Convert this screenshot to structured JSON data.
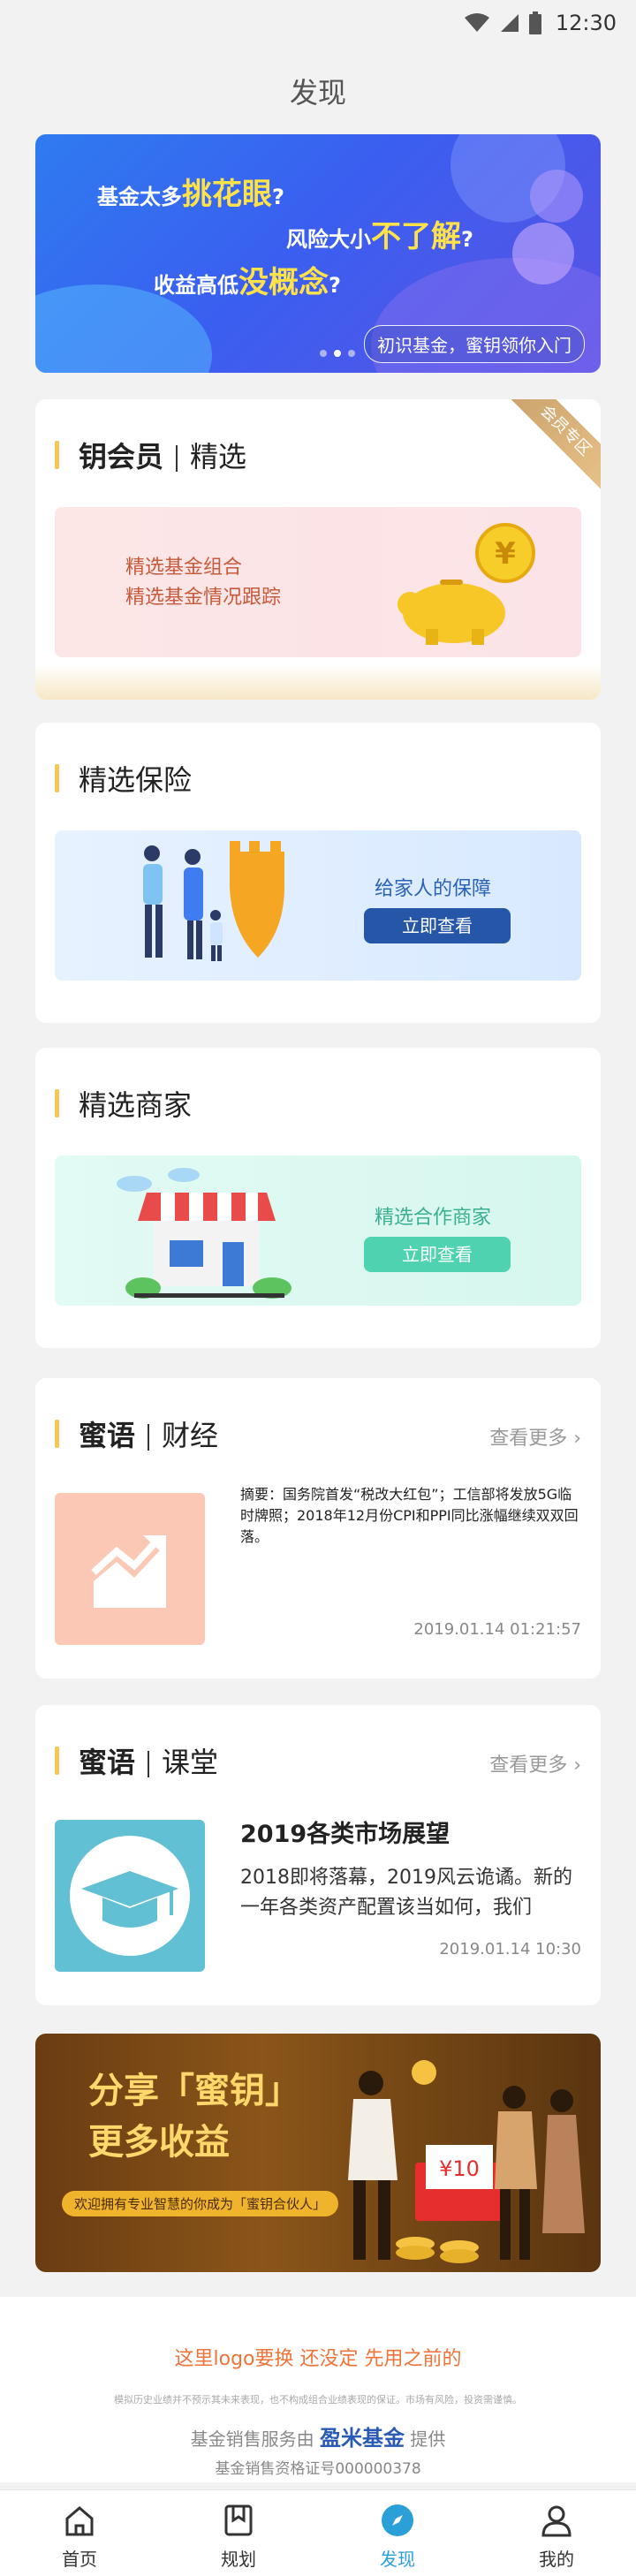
{
  "status_bar": {
    "time": "12:30"
  },
  "page": {
    "title": "发现"
  },
  "hero": {
    "line1_prefix": "基金太多",
    "line1_highlight": "挑花眼",
    "line1_suffix": "?",
    "line2_prefix": "风险大小",
    "line2_highlight": "不了解",
    "line2_suffix": "?",
    "line3_prefix": "收益高低",
    "line3_highlight": "没概念",
    "line3_suffix": "?",
    "cta": "初识基金，蜜钥领你入门",
    "slides": 3,
    "active_slide": 2
  },
  "vip_card": {
    "title_bold": "钥会员",
    "title_sub": "精选",
    "badge": "会员专区",
    "line1": "精选基金组合",
    "line2": "精选基金情况跟踪",
    "coin_symbol": "¥"
  },
  "insurance_card": {
    "title": "精选保险",
    "text": "给家人的保障",
    "button": "立即查看"
  },
  "merchant_card": {
    "title": "精选商家",
    "text": "精选合作商家",
    "button": "立即查看"
  },
  "finance_card": {
    "title_bold": "蜜语",
    "title_sub": "财经",
    "more": "查看更多 ›",
    "summary": "摘要：国务院首发“税改大红包”；工信部将发放5G临时牌照；2018年12月份CPI和PPI同比涨幅继续双双回落。",
    "time": "2019.01.14   01:21:57"
  },
  "class_card": {
    "title_bold": "蜜语",
    "title_sub": "课堂",
    "more": "查看更多 ›",
    "headline": "2019各类市场展望",
    "summary": "2018即将落幕，2019风云诡谲。新的一年各类资产配置该当如何，我们",
    "time": "2019.01.14   10:30"
  },
  "promo": {
    "line1": "分享「蜜钥」",
    "line2": "更多收益",
    "pill": "欢迎拥有专业智慧的你成为「蜜钥合伙人」",
    "envelope_amount": "¥10"
  },
  "footer": {
    "logo_text": "这里logo要换 还没定 先用之前的",
    "disclaimer": "模拟历史业绩并不预示其未来表现，也不构成组合业绩表现的保证。市场有风险，投资需谨慎。",
    "service_prefix": "基金销售服务由",
    "service_brand": "盈米基金",
    "service_suffix": "提供",
    "license": "基金销售资格证号000000378"
  },
  "tabs": [
    {
      "label": "首页",
      "icon": "home-icon"
    },
    {
      "label": "规划",
      "icon": "bookmark-icon"
    },
    {
      "label": "发现",
      "icon": "compass-icon",
      "active": true
    },
    {
      "label": "我的",
      "icon": "user-icon"
    }
  ],
  "colors": {
    "accent_bar": "#f7c65a",
    "tab_active": "#2a9fd8",
    "hero_highlight": "#ffe24a"
  }
}
